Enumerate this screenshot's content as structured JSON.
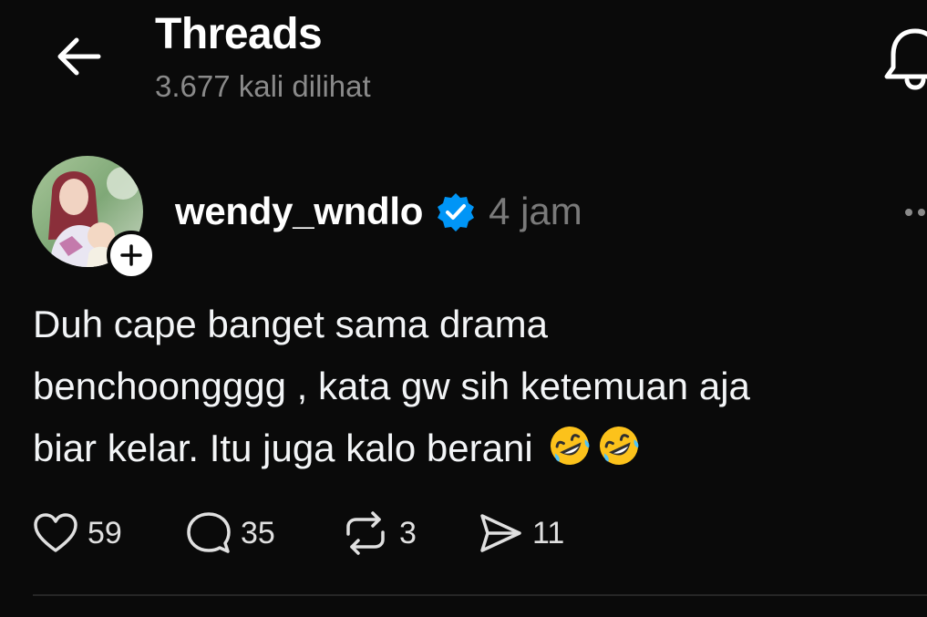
{
  "header": {
    "title": "Threads",
    "subtitle": "3.677 kali dilihat",
    "back_icon": "arrow-left-icon",
    "bell_icon": "bell-icon"
  },
  "post": {
    "username": "wendy_wndlo",
    "verified": true,
    "time": "4 jam",
    "text": "Duh cape banget sama drama\nbenchoongggg , kata gw sih ketemuan aja\nbiar kelar. Itu juga kalo berani",
    "emoji": "rolling-on-floor-laughing x2"
  },
  "actions": {
    "likes": "59",
    "comments": "35",
    "reposts": "3",
    "shares": "11"
  },
  "colors": {
    "background": "#0a0a0a",
    "verified": "#0095f6",
    "muted": "#8a8a8a"
  }
}
